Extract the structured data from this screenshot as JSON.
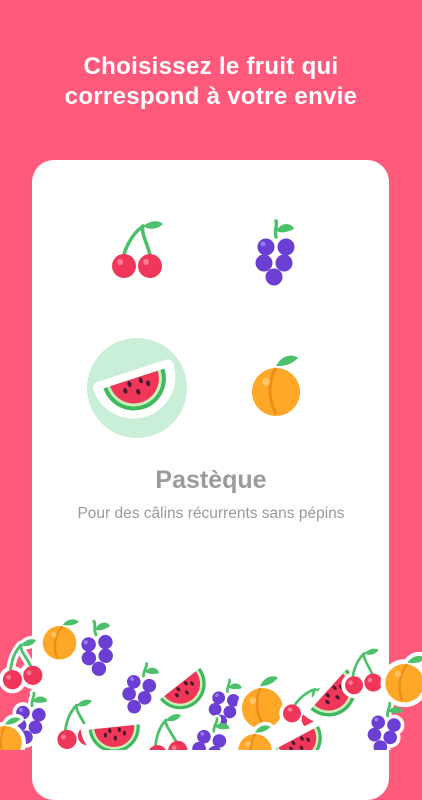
{
  "header": {
    "line1": "Choisissez le fruit qui",
    "line2": "correspond à votre envie"
  },
  "fruits": [
    {
      "name": "cherry",
      "icon": "cherry-icon",
      "selected": false
    },
    {
      "name": "grape",
      "icon": "grape-icon",
      "selected": false
    },
    {
      "name": "watermelon",
      "icon": "watermelon-icon",
      "selected": true
    },
    {
      "name": "peach",
      "icon": "peach-icon",
      "selected": false
    }
  ],
  "selection": {
    "title": "Pastèque",
    "description": "Pour des câlins récurrents sans pépins"
  },
  "colors": {
    "background": "#FF5A7C",
    "card": "#FFFFFF",
    "halo": "#C9EFD8",
    "text_muted": "#9B9B9B"
  }
}
